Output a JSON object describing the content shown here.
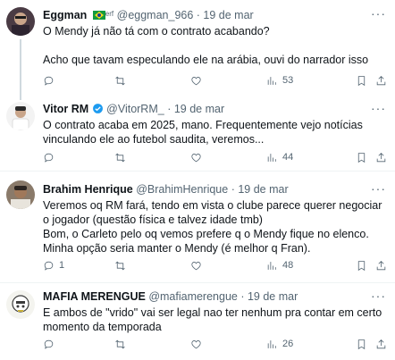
{
  "tweets": [
    {
      "name": "Eggman",
      "handle": "@eggman_966",
      "date": "· 19 de mar",
      "suffix": "erf",
      "text": "O Mendy já não tá com o contrato acabando?\n\nAcho que tavam especulando ele na arábia, ouvi do narrador isso",
      "replies": "",
      "retweets": "",
      "likes": "",
      "views": "53"
    },
    {
      "name": "Vitor RM",
      "handle": "@VitorRM_",
      "date": "· 19 de mar",
      "text": "O contrato acaba em 2025, mano. Frequentemente vejo notícias vinculando ele ao futebol saudita, veremos...",
      "replies": "",
      "retweets": "",
      "likes": "",
      "views": "44"
    },
    {
      "name": "Brahim Henrique",
      "handle": "@BrahimHenrique",
      "date": "· 19 de mar",
      "text": "Veremos oq RM fará, tendo em vista o clube parece querer negociar o jogador (questão física e talvez idade tmb)\nBom, o Carleto pelo oq vemos prefere q o Mendy fique no elenco.\nMinha opção seria manter o Mendy (é melhor q Fran).",
      "replies": "1",
      "retweets": "",
      "likes": "",
      "views": "48"
    },
    {
      "name": "MAFIA MERENGUE",
      "handle": "@mafiamerengue",
      "date": "· 19 de mar",
      "text": "E ambos de \"vrido\" vai ser legal nao ter nenhum pra contar em certo momento da temporada",
      "replies": "",
      "retweets": "",
      "likes": "",
      "views": "26"
    }
  ],
  "icons": [
    "more-icon",
    "reply-icon",
    "retweet-icon",
    "like-icon",
    "views-icon",
    "bookmark-icon",
    "share-icon"
  ],
  "colors": {
    "secondary_text": "#536471",
    "text": "#0f1419",
    "separator": "#eff3f4",
    "flag_green": "#129b3f"
  }
}
